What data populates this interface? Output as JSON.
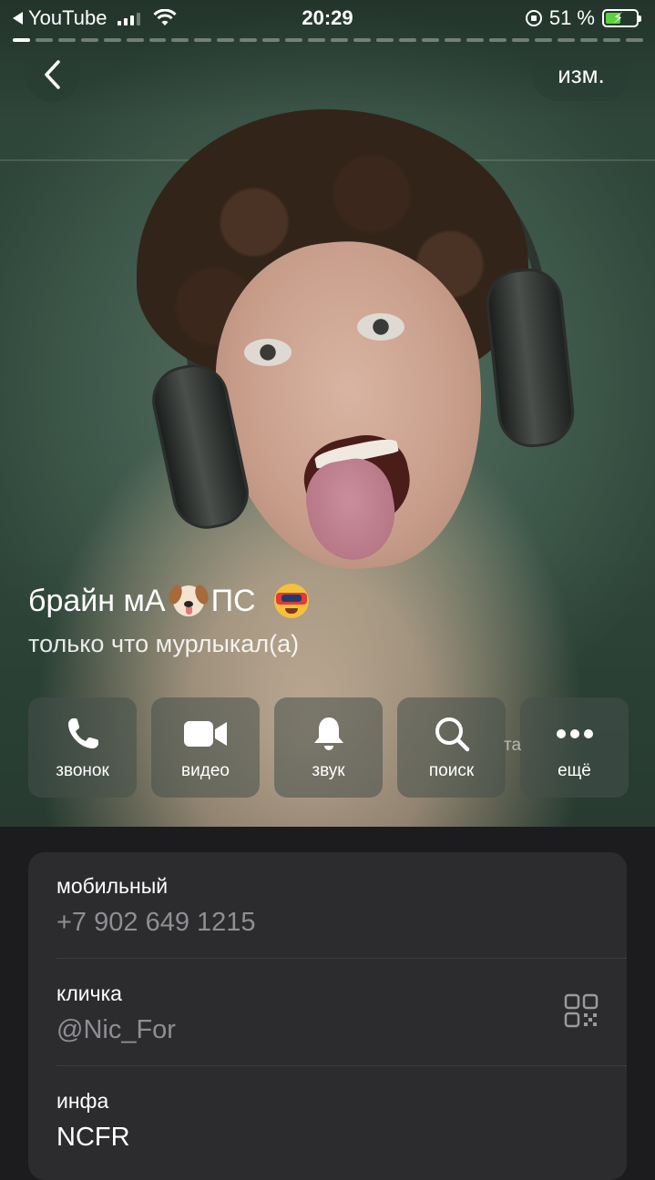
{
  "status_bar": {
    "back_app": "YouTube",
    "time": "20:29",
    "battery_percent": "51 %",
    "battery_level": 0.51,
    "signal_bars": 3,
    "icons": [
      "back-arrow-icon",
      "signal-icon",
      "wifi-icon",
      "rotation-lock-icon",
      "battery-charging-icon"
    ]
  },
  "nav": {
    "back_icon": "chevron-left-icon",
    "edit_label": "изм."
  },
  "profile": {
    "name_part1": "брайн мА",
    "name_part2": "ПС",
    "name_emojis": [
      "dog-face-emoji",
      "vr-goggles-emoji"
    ],
    "status": "только что мурлыкал(а)"
  },
  "actions": [
    {
      "label": "звонок",
      "icon": "phone-icon"
    },
    {
      "label": "видео",
      "icon": "video-camera-icon"
    },
    {
      "label": "звук",
      "icon": "bell-icon"
    },
    {
      "label": "поиск",
      "icon": "search-icon"
    },
    {
      "label": "ещё",
      "icon": "more-dots-icon"
    }
  ],
  "ghost_text": "та",
  "info": {
    "mobile_label": "мобильный",
    "mobile_value": "+7 902 649 1215",
    "nickname_label": "кличка",
    "nickname_value": "@Nic_For",
    "nickname_icon": "qr-code-icon",
    "bio_label": "инфа",
    "bio_value": "NCFR"
  },
  "colors": {
    "background": "#1c1c1e",
    "card": "#2c2c2e",
    "secondary_text": "#8e8e93",
    "battery_fill": "#5ad33c"
  }
}
